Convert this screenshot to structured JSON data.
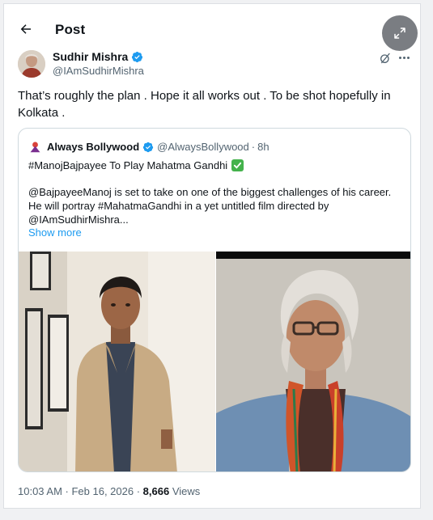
{
  "header": {
    "title": "Post",
    "back_icon": "arrow-left-icon",
    "expand_icon": "expand-icon"
  },
  "author": {
    "name": "Sudhir Mishra",
    "handle": "@IAmSudhirMishra",
    "verified_color": "#1d9bf0"
  },
  "tweet": {
    "line1": "That’s roughly the plan . Hope it all works out . To be shot hopefully in",
    "line2": "Kolkata ."
  },
  "quote": {
    "name": "Always Bollywood",
    "handle": "@AlwaysBollywood",
    "separator": "·",
    "time": "8h",
    "headline": "#ManojBajpayee To Play Mahatma Gandhi",
    "body_line1": "@BajpayeeManoj is set to take on one of the biggest challenges of his career.",
    "body_line2": "He will portray #MahatmaGandhi in a yet untitled film directed by",
    "body_line3": "@IAmSudhirMishra...",
    "show_more": "Show more"
  },
  "meta": {
    "time": "10:03 AM · Feb 16, 2026 · ",
    "views": "8,666",
    "views_label": " Views"
  },
  "colors": {
    "accent": "#1d9bf0",
    "muted": "#536471",
    "text": "#0f1419"
  }
}
